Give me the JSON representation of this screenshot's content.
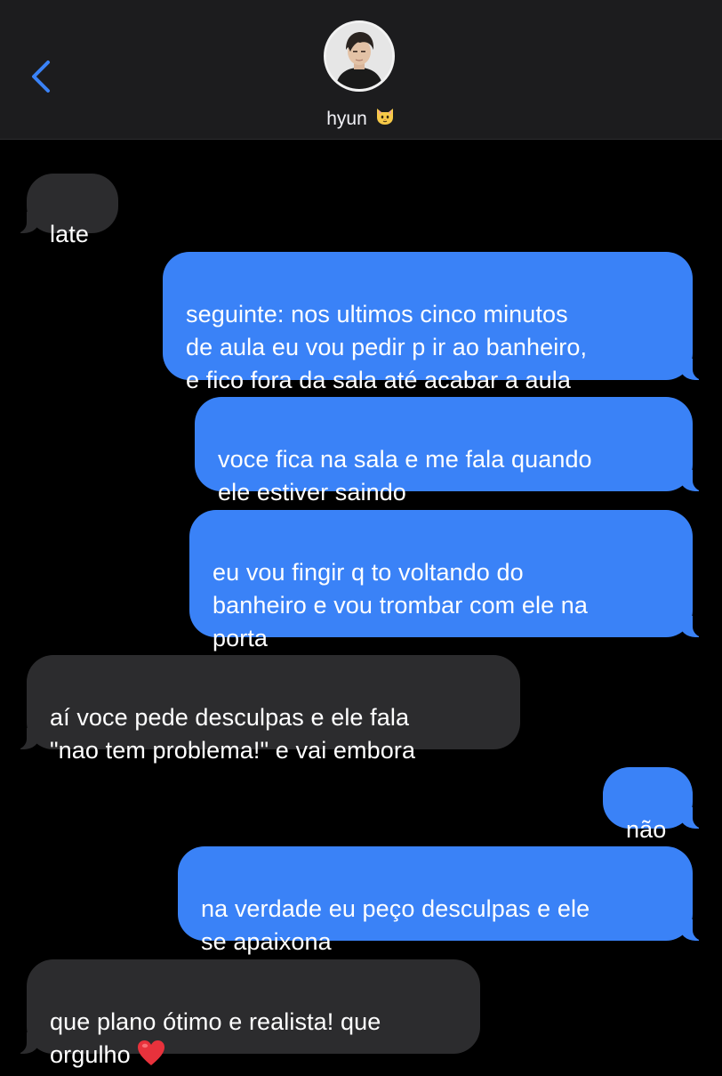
{
  "contact": {
    "name": "hyun",
    "emoji_icon": "cat-face-icon"
  },
  "colors": {
    "outgoing_bubble": "#3a82f7",
    "incoming_bubble": "#2c2c2e",
    "accent": "#3a82f7",
    "background": "#000000",
    "header": "#1c1c1e"
  },
  "messages": [
    {
      "direction": "incoming",
      "text": "late"
    },
    {
      "direction": "outgoing",
      "text": "seguinte: nos ultimos cinco minutos\nde aula eu vou pedir p ir ao banheiro,\ne fico fora da sala até acabar a aula"
    },
    {
      "direction": "outgoing",
      "text": "voce fica na sala e me fala quando\nele estiver saindo"
    },
    {
      "direction": "outgoing",
      "text": "eu vou fingir q to voltando do\nbanheiro e vou trombar com ele na\nporta"
    },
    {
      "direction": "incoming",
      "text": "aí voce pede desculpas e ele fala\n\"nao tem problema!\" e vai embora"
    },
    {
      "direction": "outgoing",
      "text": "não"
    },
    {
      "direction": "outgoing",
      "text": "na verdade eu peço desculpas e ele\nse apaixona"
    },
    {
      "direction": "incoming",
      "text": "que plano ótimo e realista! que\norgulho",
      "emoji_icon": "red-heart-icon"
    }
  ]
}
